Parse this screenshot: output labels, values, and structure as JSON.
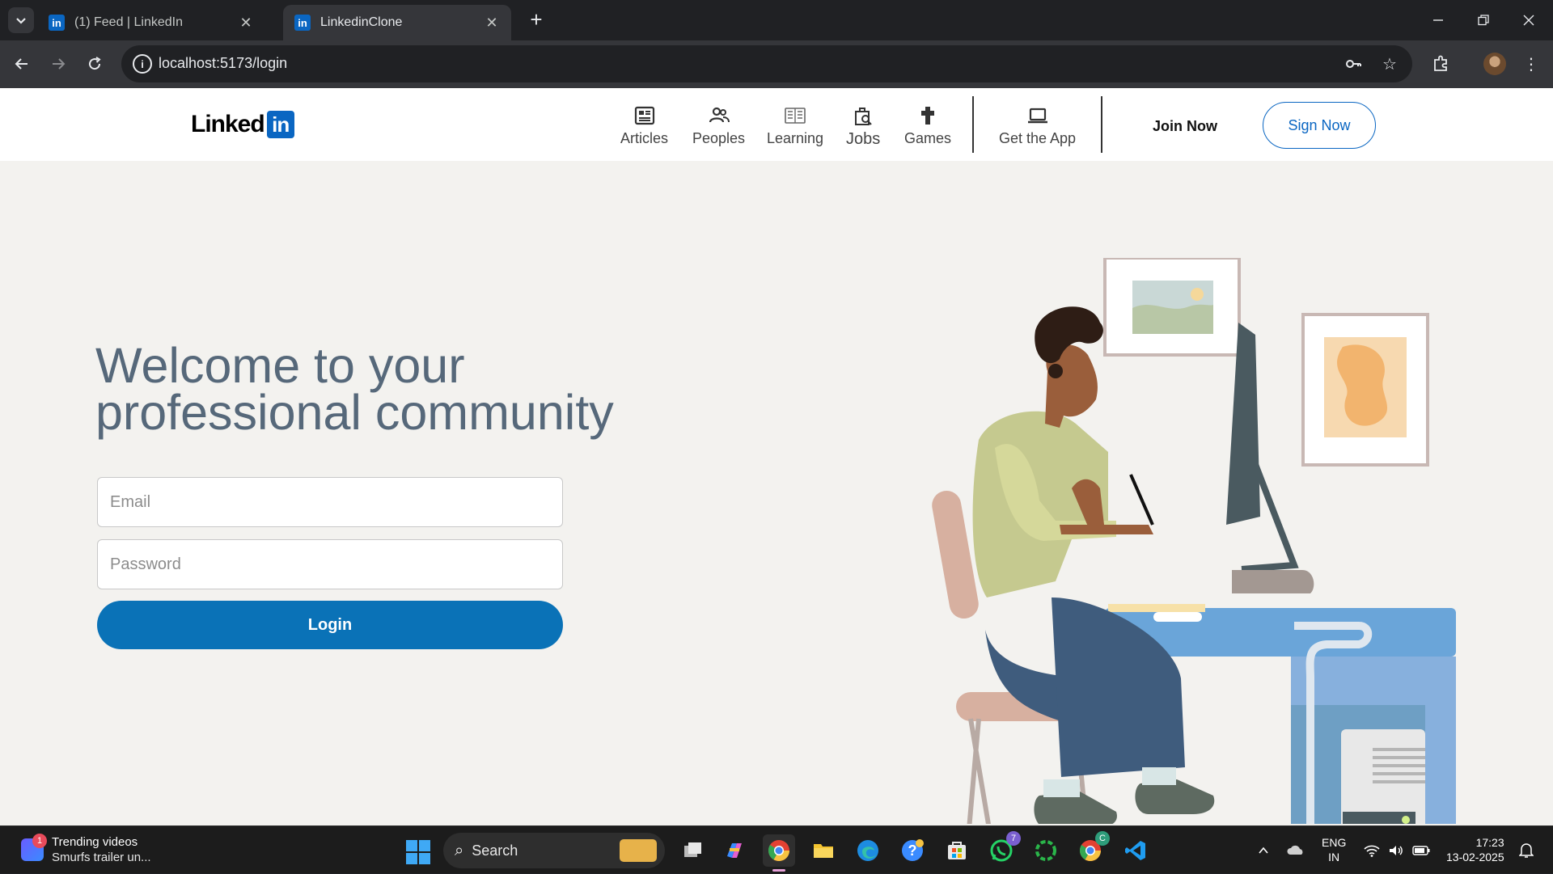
{
  "browser": {
    "tabs": [
      {
        "title": "(1) Feed | LinkedIn",
        "favicon": "in",
        "active": false
      },
      {
        "title": "LinkedinClone",
        "favicon": "in",
        "active": true
      }
    ],
    "new_tab_glyph": "+",
    "url": "localhost:5173/login"
  },
  "site": {
    "logo_text": "Linked",
    "logo_badge": "in",
    "nav": [
      {
        "label": "Articles",
        "icon": "articles-icon"
      },
      {
        "label": "Peoples",
        "icon": "people-icon"
      },
      {
        "label": "Learning",
        "icon": "learning-icon"
      },
      {
        "label": "Jobs",
        "icon": "jobs-icon"
      },
      {
        "label": "Games",
        "icon": "games-icon"
      },
      {
        "label": "Get the App",
        "icon": "laptop-icon"
      }
    ],
    "join_label": "Join Now",
    "sign_label": "Sign Now",
    "accent": "#0a66c2"
  },
  "login": {
    "headline_line1": "Welcome to your",
    "headline_line2": "professional community",
    "email_placeholder": "Email",
    "password_placeholder": "Password",
    "button_label": "Login",
    "button_color": "#0a72b7"
  },
  "taskbar": {
    "widget_badge": "1",
    "widget_title": "Trending videos",
    "widget_subtitle": "Smurfs trailer un...",
    "search_label": "Search",
    "whatsapp_badge": "7",
    "chrome_profile_badge": "C",
    "lang_line1": "ENG",
    "lang_line2": "IN",
    "time": "17:23",
    "date": "13-02-2025"
  }
}
